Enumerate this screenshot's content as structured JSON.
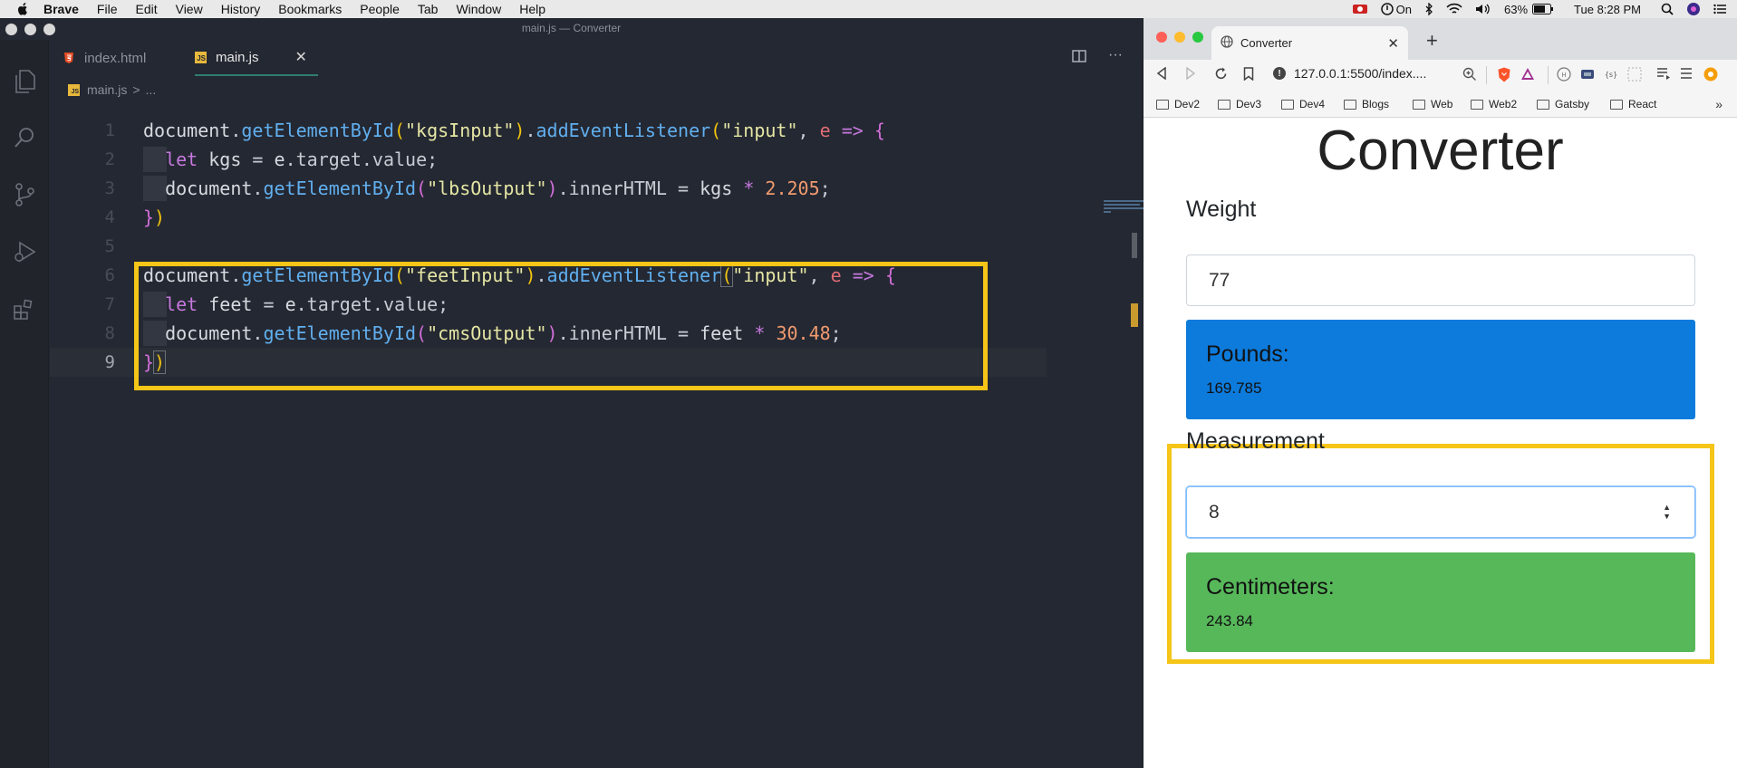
{
  "menubar": {
    "app": "Brave",
    "items": [
      "File",
      "Edit",
      "View",
      "History",
      "Bookmarks",
      "People",
      "Tab",
      "Window",
      "Help"
    ],
    "status_on": "On",
    "battery": "63%",
    "clock": "Tue 8:28 PM"
  },
  "vscode": {
    "window_title": "main.js — Converter",
    "tabs": [
      {
        "label": "index.html",
        "icon": "html5-icon"
      },
      {
        "label": "main.js",
        "icon": "javascript-icon",
        "active": true
      }
    ],
    "breadcrumb": {
      "file": "main.js",
      "separator": ">",
      "more": "..."
    },
    "line_numbers": [
      "1",
      "2",
      "3",
      "4",
      "5",
      "6",
      "7",
      "8",
      "9"
    ],
    "current_line": 9
  },
  "browser": {
    "tab_title": "Converter",
    "url": "127.0.0.1:5500/index....",
    "bookmarks": [
      "Dev2",
      "Dev3",
      "Dev4",
      "Blogs",
      "Web",
      "Web2",
      "Gatsby",
      "React"
    ]
  },
  "page": {
    "heading": "Converter",
    "weight_label": "Weight",
    "weight_value": "77",
    "pounds_label": "Pounds:",
    "pounds_value": "169.785",
    "measurement_label": "Measurement",
    "measurement_value": "8",
    "cms_label": "Centimeters:",
    "cms_value": "243.84"
  },
  "colors": {
    "highlight_box": "#f5c518",
    "pounds_card": "#0d7bdc",
    "cms_card": "#57b85a"
  }
}
